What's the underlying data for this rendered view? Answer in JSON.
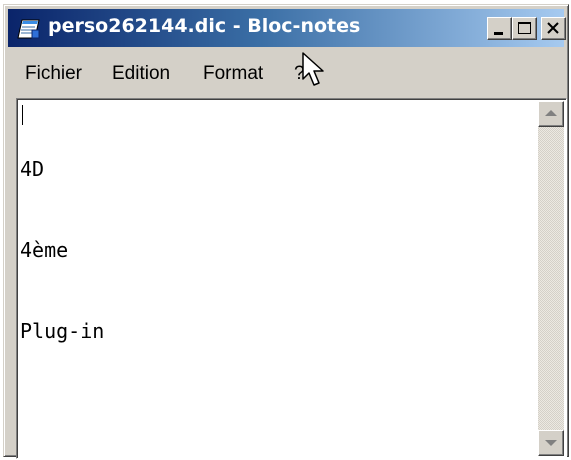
{
  "window": {
    "title": "perso262144.dic - Bloc-notes",
    "colors": {
      "title_gradient_start": "#0a246a",
      "title_gradient_end": "#a6caf0",
      "chrome": "#d4d0c8"
    }
  },
  "icons": {
    "app": "notepad-icon",
    "minimize": "minimize-icon",
    "maximize": "maximize-icon",
    "close": "close-icon",
    "scroll_up": "arrow-up-icon",
    "scroll_down": "arrow-down-icon",
    "cursor": "mouse-pointer-icon"
  },
  "menu": {
    "items": [
      {
        "label": "Fichier"
      },
      {
        "label": "Edition"
      },
      {
        "label": "Format"
      },
      {
        "label": "?"
      }
    ]
  },
  "editor": {
    "lines": [
      "4D",
      "4ème",
      "Plug-in"
    ]
  }
}
